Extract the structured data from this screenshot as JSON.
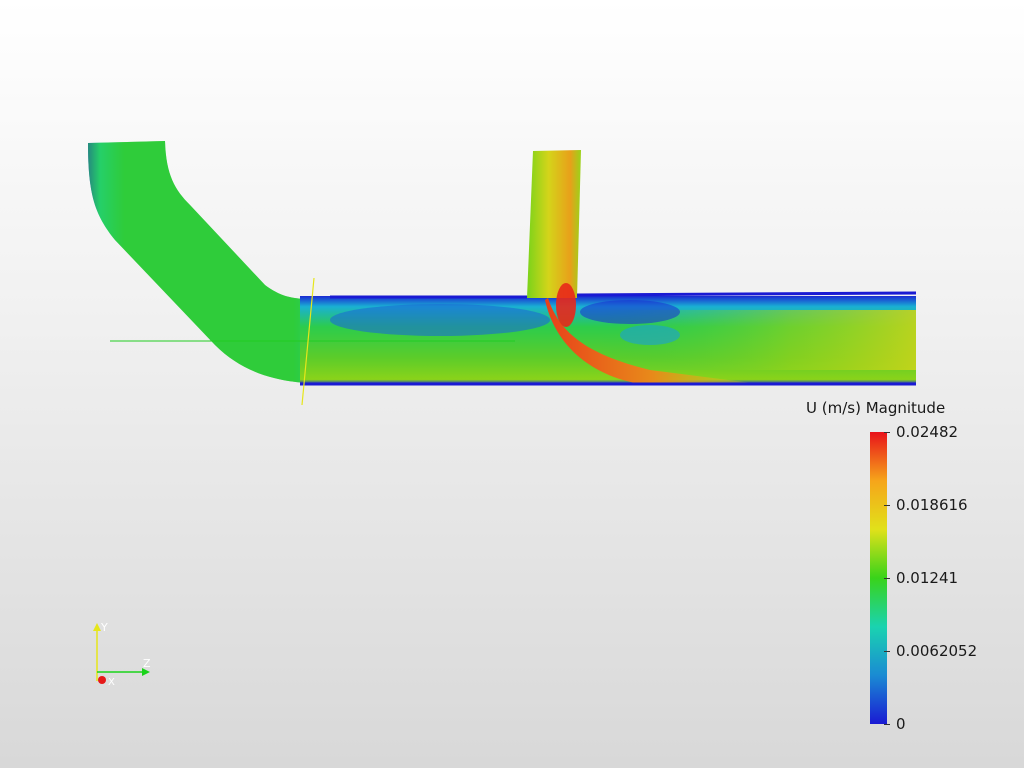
{
  "scene": {
    "background_top": "#ffffff",
    "background_bottom": "#d8d8d8",
    "domain_colors": {
      "low": "#0a1fc8",
      "cyan": "#19c8c8",
      "mid": "#1ccc3c",
      "yellow": "#cccc1a",
      "high": "#e8401a"
    }
  },
  "legend": {
    "title": "U (m/s) Magnitude",
    "max_label": "0.02482",
    "tick_2_label": "0.018616",
    "tick_3_label": "0.01241",
    "tick_4_label": "0.0062052",
    "min_label": "0",
    "colormap": [
      "#e8121a",
      "#f6a51a",
      "#e1e11a",
      "#39d31a",
      "#1ad3b0",
      "#1a8bd3",
      "#1a1ad3"
    ]
  },
  "orientation_axes": {
    "y_label": "Y",
    "z_label": "Z",
    "x_label": "X",
    "y_color": "#e6e61a",
    "z_color": "#1ad31a",
    "x_color": "#e61a1a"
  }
}
